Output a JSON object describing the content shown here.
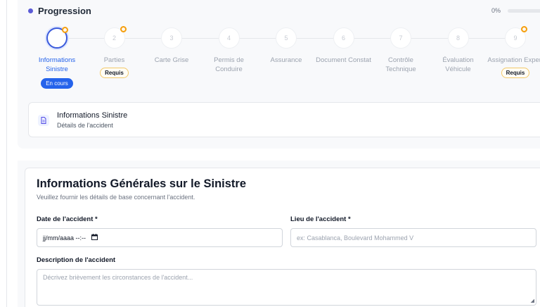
{
  "progress": {
    "title": "Progression",
    "percent_text": "0%",
    "percent_value": 0,
    "accent_color": "#2563eb",
    "steps": [
      {
        "number": "",
        "label": "Informations Sinistre",
        "status": "En cours",
        "required": "",
        "flag": true
      },
      {
        "number": "2",
        "label": "Parties",
        "status": "",
        "required": "Requis",
        "flag": true
      },
      {
        "number": "3",
        "label": "Carte Grise",
        "status": "",
        "required": "",
        "flag": false
      },
      {
        "number": "4",
        "label": "Permis de Conduire",
        "status": "",
        "required": "",
        "flag": false
      },
      {
        "number": "5",
        "label": "Assurance",
        "status": "",
        "required": "",
        "flag": false
      },
      {
        "number": "6",
        "label": "Document Constat",
        "status": "",
        "required": "",
        "flag": false
      },
      {
        "number": "7",
        "label": "Contrôle Technique",
        "status": "",
        "required": "",
        "flag": false
      },
      {
        "number": "8",
        "label": "Évaluation Véhicule",
        "status": "",
        "required": "",
        "flag": false
      },
      {
        "number": "9",
        "label": "Assignation Expert",
        "status": "",
        "required": "Requis",
        "flag": true
      }
    ]
  },
  "section": {
    "title": "Informations Sinistre",
    "subtitle": "Détails de l'accident",
    "icon": "document-icon"
  },
  "form": {
    "title": "Informations Générales sur le Sinistre",
    "subtitle": "Veuillez fournir les détails de base concernant l'accident.",
    "date_label": "Date de l'accident *",
    "date_value": "jj/mm/aaaa --:--",
    "location_label": "Lieu de l'accident *",
    "location_placeholder": "ex: Casablanca, Boulevard Mohammed V",
    "description_label": "Description de l'accident",
    "description_placeholder": "Décrivez brièvement les circonstances de l'accident..."
  }
}
